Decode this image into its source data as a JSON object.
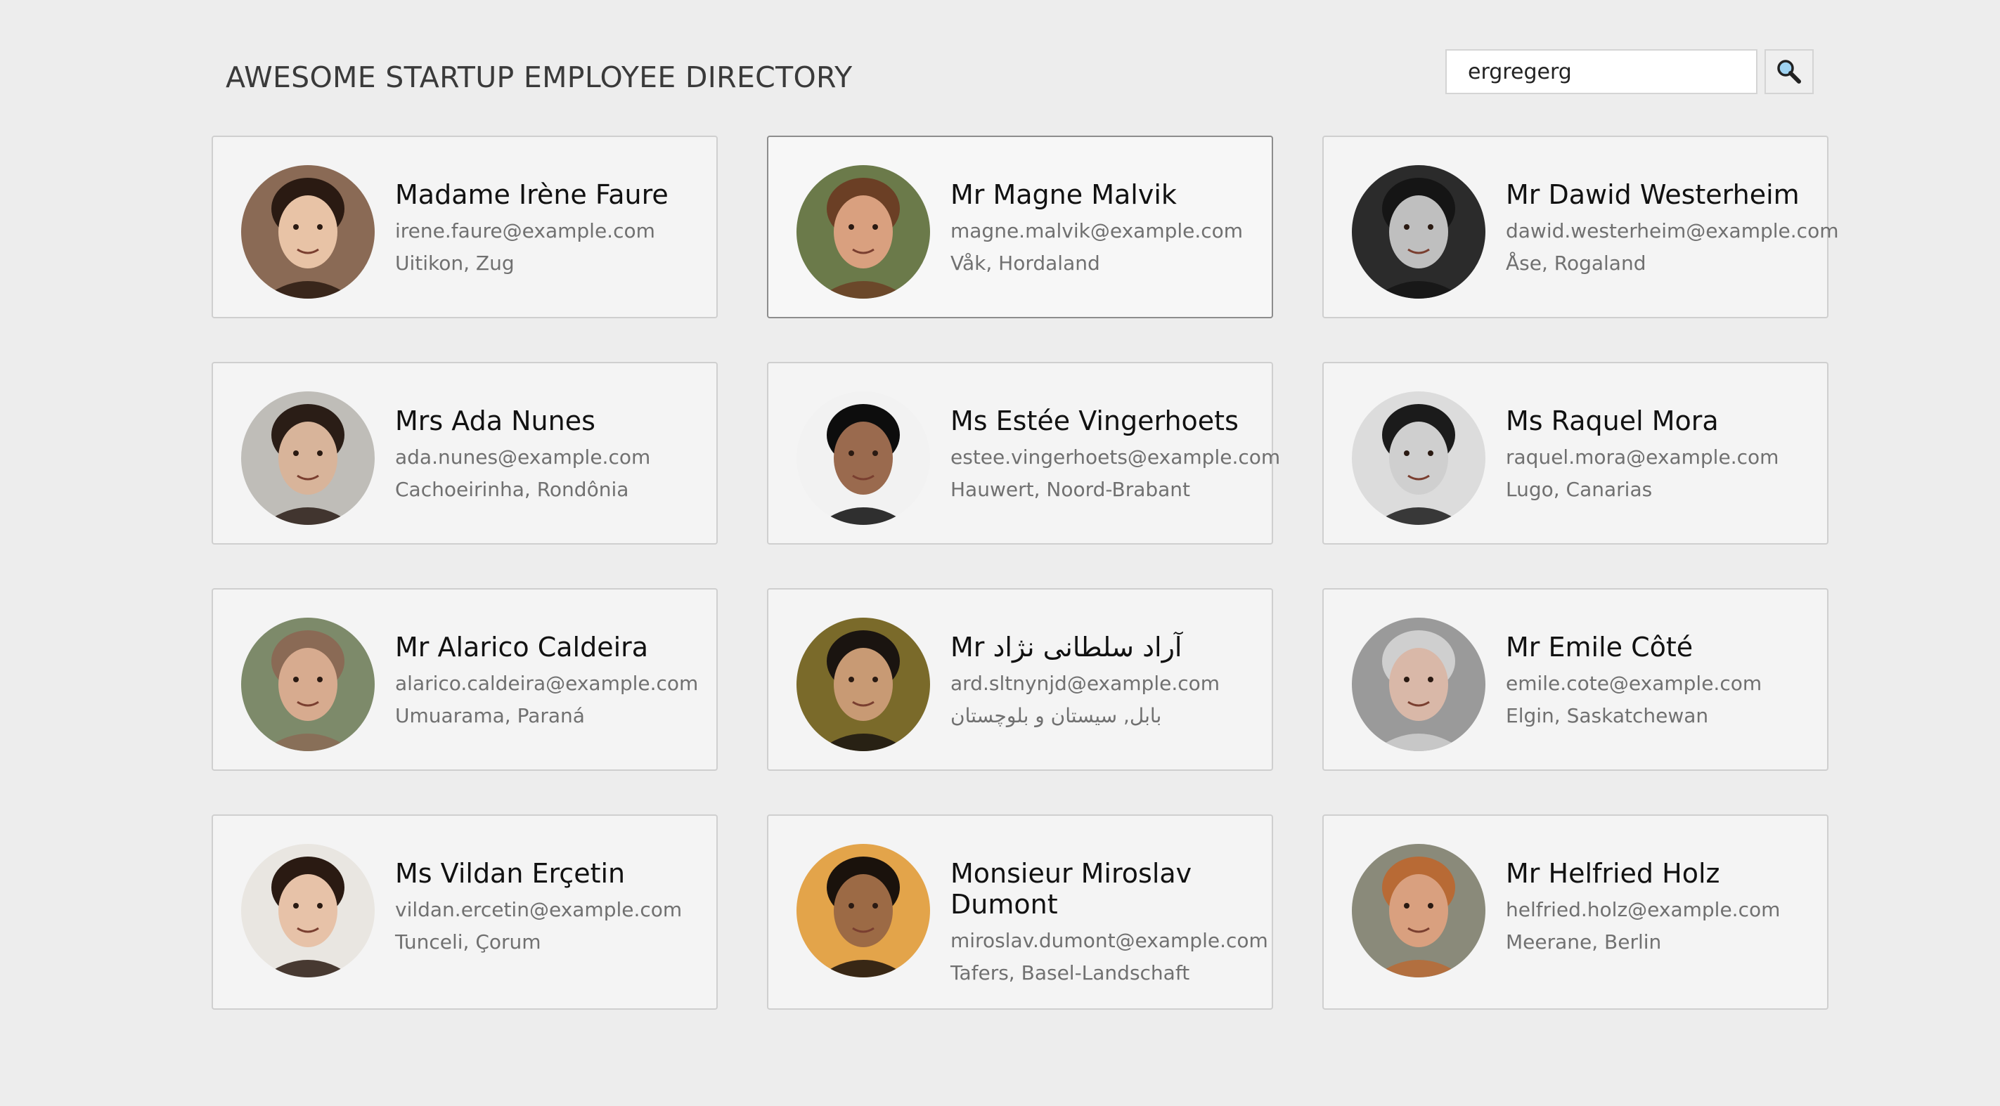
{
  "header": {
    "title": "AWESOME STARTUP EMPLOYEE DIRECTORY",
    "search_value": "ergregerg",
    "search_icon": "magnifier-icon"
  },
  "employees": [
    {
      "name": "Madame Irène Faure",
      "email": "irene.faure@example.com",
      "location": "Uitikon, Zug",
      "avatar_bg": "#8a6a55",
      "skin": "#e8c3a6",
      "hair": "#2a1a12"
    },
    {
      "name": "Mr Magne Malvik",
      "email": "magne.malvik@example.com",
      "location": "Våk, Hordaland",
      "avatar_bg": "#6b7a4a",
      "skin": "#d9a07f",
      "hair": "#6b3f25"
    },
    {
      "name": "Mr Dawid Westerheim",
      "email": "dawid.westerheim@example.com",
      "location": "Åse, Rogaland",
      "avatar_bg": "#2b2b2b",
      "skin": "#bfbfbf",
      "hair": "#151515"
    },
    {
      "name": "Mrs Ada Nunes",
      "email": "ada.nunes@example.com",
      "location": "Cachoeirinha, Rondônia",
      "avatar_bg": "#bfbdb8",
      "skin": "#d8b49a",
      "hair": "#2a1d16"
    },
    {
      "name": "Ms Estée Vingerhoets",
      "email": "estee.vingerhoets@example.com",
      "location": "Hauwert, Noord-Brabant",
      "avatar_bg": "#f2f2f2",
      "skin": "#9a6a4e",
      "hair": "#0d0d0d"
    },
    {
      "name": "Ms Raquel Mora",
      "email": "raquel.mora@example.com",
      "location": "Lugo, Canarias",
      "avatar_bg": "#dcdcdc",
      "skin": "#cfcfcf",
      "hair": "#1b1b1b"
    },
    {
      "name": "Mr Alarico Caldeira",
      "email": "alarico.caldeira@example.com",
      "location": "Umuarama, Paraná",
      "avatar_bg": "#7d8a6a",
      "skin": "#d7ab8f",
      "hair": "#8a6a55"
    },
    {
      "name": "Mr آراد سلطانی نژاد",
      "email": "ard.sltnynjd@example.com",
      "location": "بابل, سیستان و بلوچستان",
      "avatar_bg": "#7a6a2a",
      "skin": "#c89a74",
      "hair": "#1a1410"
    },
    {
      "name": "Mr Emile Côté",
      "email": "emile.cote@example.com",
      "location": "Elgin, Saskatchewan",
      "avatar_bg": "#9a9a9a",
      "skin": "#d9b8a8",
      "hair": "#cfcfcf"
    },
    {
      "name": "Ms Vildan Erçetin",
      "email": "vildan.ercetin@example.com",
      "location": "Tunceli, Çorum",
      "avatar_bg": "#e9e6e1",
      "skin": "#e7c2a8",
      "hair": "#2a1a12"
    },
    {
      "name": "Monsieur Miroslav Dumont",
      "email": "miroslav.dumont@example.com",
      "location": "Tafers, Basel-Landschaft",
      "avatar_bg": "#e3a44a",
      "skin": "#9c6a45",
      "hair": "#1a120c"
    },
    {
      "name": "Mr Helfried Holz",
      "email": "helfried.holz@example.com",
      "location": "Meerane, Berlin",
      "avatar_bg": "#8a8a7a",
      "skin": "#d9a07f",
      "hair": "#b86a35"
    }
  ]
}
